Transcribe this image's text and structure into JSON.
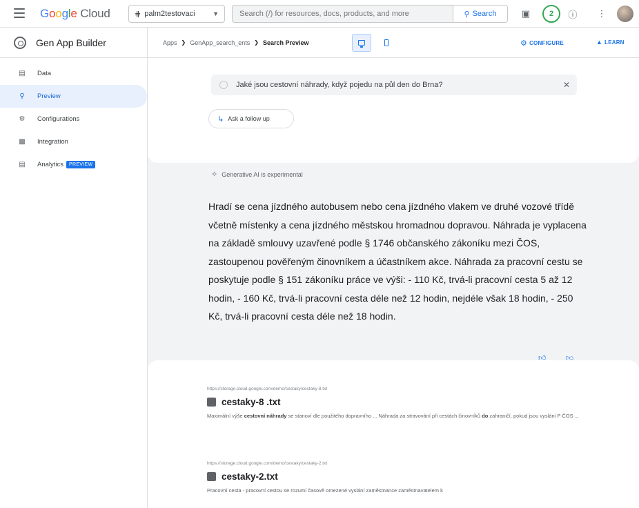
{
  "topbar": {
    "logo": {
      "G": "G",
      "o1": "o",
      "o2": "o",
      "g": "g",
      "l": "l",
      "e": "e",
      "cloud": " Cloud"
    },
    "project": "palm2testovaci",
    "search_placeholder": "Search (/) for resources, docs, products, and more",
    "search_button": "Search",
    "notifications_count": "2",
    "icons": [
      "menu-icon",
      "terminal-icon",
      "help-icon",
      "more-vert-icon",
      "avatar"
    ]
  },
  "sidebar": {
    "title": "Gen App Builder",
    "items": [
      {
        "label": "Data",
        "icon": "data-icon"
      },
      {
        "label": "Preview",
        "icon": "search-icon"
      },
      {
        "label": "Configurations",
        "icon": "gear-icon"
      },
      {
        "label": "Integration",
        "icon": "integration-icon"
      },
      {
        "label": "Analytics",
        "icon": "analytics-icon",
        "badge": "PREVIEW"
      }
    ]
  },
  "subbar": {
    "breadcrumbs": [
      "Apps",
      "GenApp_search_ents",
      "Search Preview"
    ],
    "configure": "CONFIGURE",
    "learn": "LEARN"
  },
  "query": {
    "text": "Jaké jsou cestovní náhrady, když pojedu na půl den do Brna?",
    "follow_up": "Ask a follow up"
  },
  "ai": {
    "label": "Generative AI is experimental",
    "answer": "Hradí se cena jízdného autobusem nebo cena jízdného vlakem ve druhé vozové třídě včetně místenky a cena jízdného městskou hromadnou dopravou. Náhrada je vyplacena na základě smlouvy uzavřené podle § 1746 občanského zákoníku mezi ČOS, zastoupenou pověřeným činovníkem a účastníkem akce. Náhrada za pracovní cestu se poskytuje podle § 151 zákoníku práce ve výši: - 110 Kč, trvá-li pracovní cesta 5 až 12 hodin, - 160 Kč, trvá-li pracovní cesta déle než 12 hodin, nejdéle však 18 hodin, - 250 Kč, trvá-li pracovní cesta déle než 18 hodin."
  },
  "results": [
    {
      "url": "https://storage.cloud.google.com/demo/cestaky/cestaky-8.txt",
      "title": "cestaky-8 .txt",
      "snippet_pre": "Maximální výše ",
      "snippet_bold": "cestovní náhrady",
      "snippet_mid": " se stanoví dle použitého dopravního ... Náhrada za stravování při cestách činovníků ",
      "snippet_bold2": "do",
      "snippet_post": " zahraničí, pokud jsou vysláni P ČOS ..."
    },
    {
      "url": "https://storage.cloud.google.com/demo/cestaky/cestaky-2.txt",
      "title": "cestaky-2.txt",
      "snippet": "Pracovní cesta - pracovní cestou se rozumí časově omezené vyslání zaměstnance zaměstnavatelem k"
    }
  ]
}
